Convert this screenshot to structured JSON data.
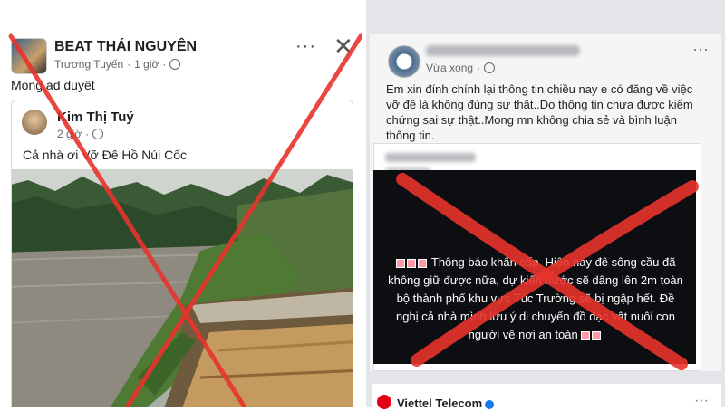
{
  "left_post": {
    "page_name": "BEAT THÁI NGUYÊN",
    "author": "Trương Tuyến",
    "time": "1 giờ",
    "separator": "·",
    "caption": "Mong ad duyệt",
    "more_label": "···",
    "close_label": "✕",
    "shared": {
      "name": "Kim Thị Tuý",
      "time": "2 giờ",
      "separator": "·",
      "text": "Cả nhà ơi Vỡ Đê Hồ Núi Cốc"
    }
  },
  "right_post": {
    "time": "Vừa xong",
    "separator": "·",
    "more_label": "···",
    "text": "Em xin đính chính lại thông tin chiều nay e có đăng về việc vỡ đê là không đúng sự thật..Do thông tin chưa được kiểm chứng sai sự thật..Mong mn không chia sẻ và bình luận thông tin.",
    "dark_text": "Thông báo khẩn cấp. Hiện nay đê sông cầu đã không giữ được nữa, dự kiến nước sẽ dâng lên 2m toàn bộ thành phố khu vực Túc Trường sẽ bị ngập hết. Đề nghị cả nhà mình lưu ý di chuyển đồ đạc vật nuôi con người về nơi an toàn"
  },
  "viettel": {
    "name": "Viettel Telecom",
    "more_label": "···"
  },
  "colors": {
    "red_x": "#e8332c",
    "fb_text": "#1c1e21",
    "meta_gray": "#65676b",
    "verified_blue": "#1877f2",
    "viettel_red": "#e30016"
  }
}
